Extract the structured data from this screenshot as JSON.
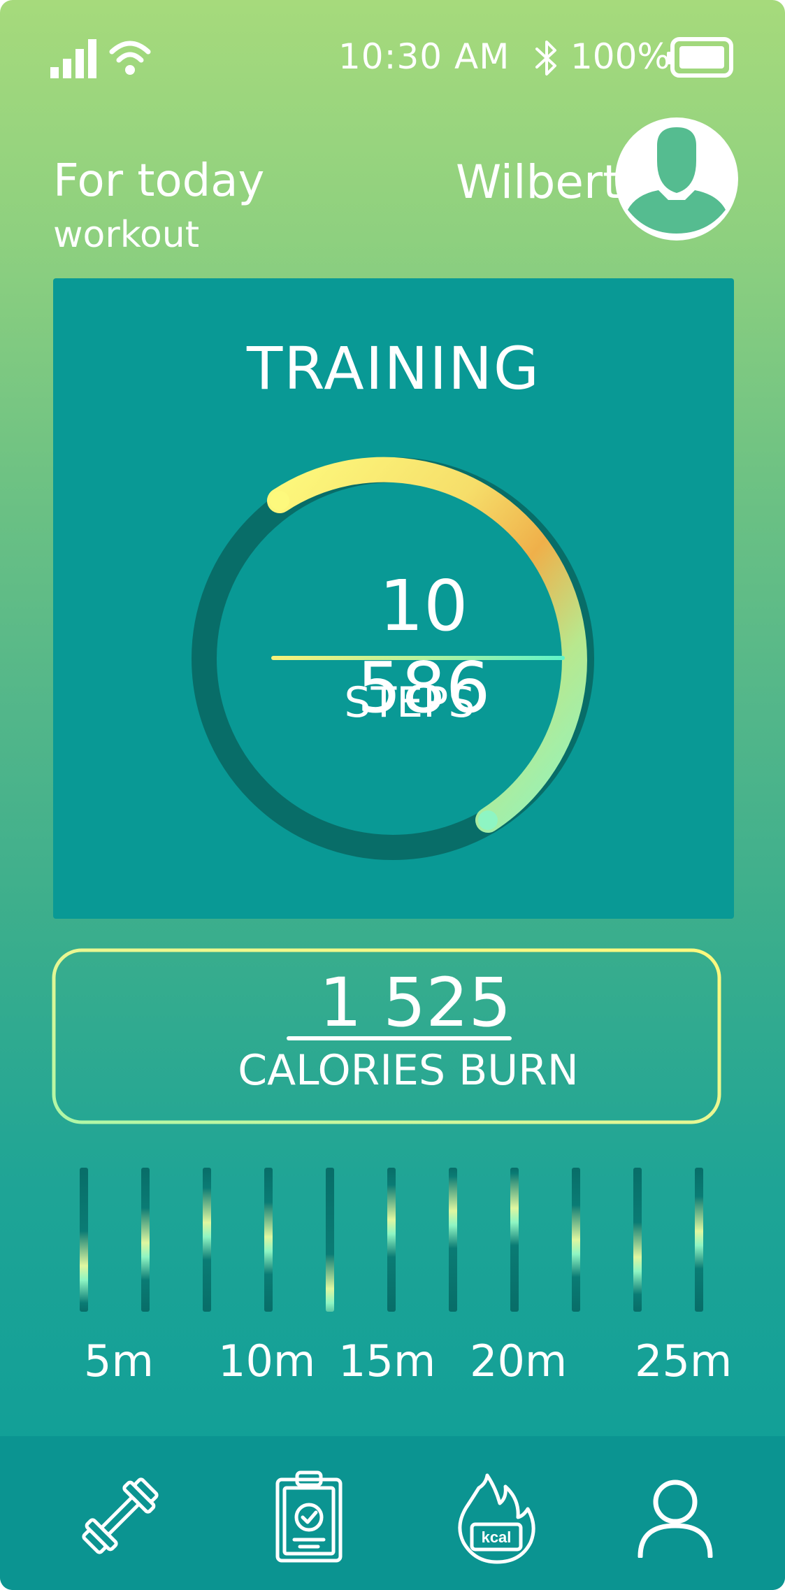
{
  "status_bar": {
    "time": "10:30 AM",
    "battery_level": "100%",
    "icons": [
      "signal-icon",
      "wifi-icon",
      "bluetooth-icon",
      "battery-icon"
    ]
  },
  "header": {
    "greeting_line1": "For today",
    "greeting_line2": "workout",
    "user_name": "Wilbert",
    "avatar_icon": "avatar-icon"
  },
  "training": {
    "title": "TRAINING",
    "steps_value": "10 586",
    "steps_label": "STEPS"
  },
  "calories": {
    "value": "1 525",
    "label": "CALORIES BURN"
  },
  "timeline": {
    "labels": [
      "5m",
      "10m",
      "15m",
      "20m",
      "25m"
    ]
  },
  "bottom_nav": {
    "items": [
      "dumbbell-icon",
      "clipboard-icon",
      "kcal-flame-icon",
      "profile-icon"
    ]
  },
  "colors": {
    "card_teal": "#099995",
    "ring_track": "#086d68",
    "accent_yellow": "#fdf97d",
    "accent_orange": "#efb04a",
    "accent_mint": "#8ef5c3"
  }
}
